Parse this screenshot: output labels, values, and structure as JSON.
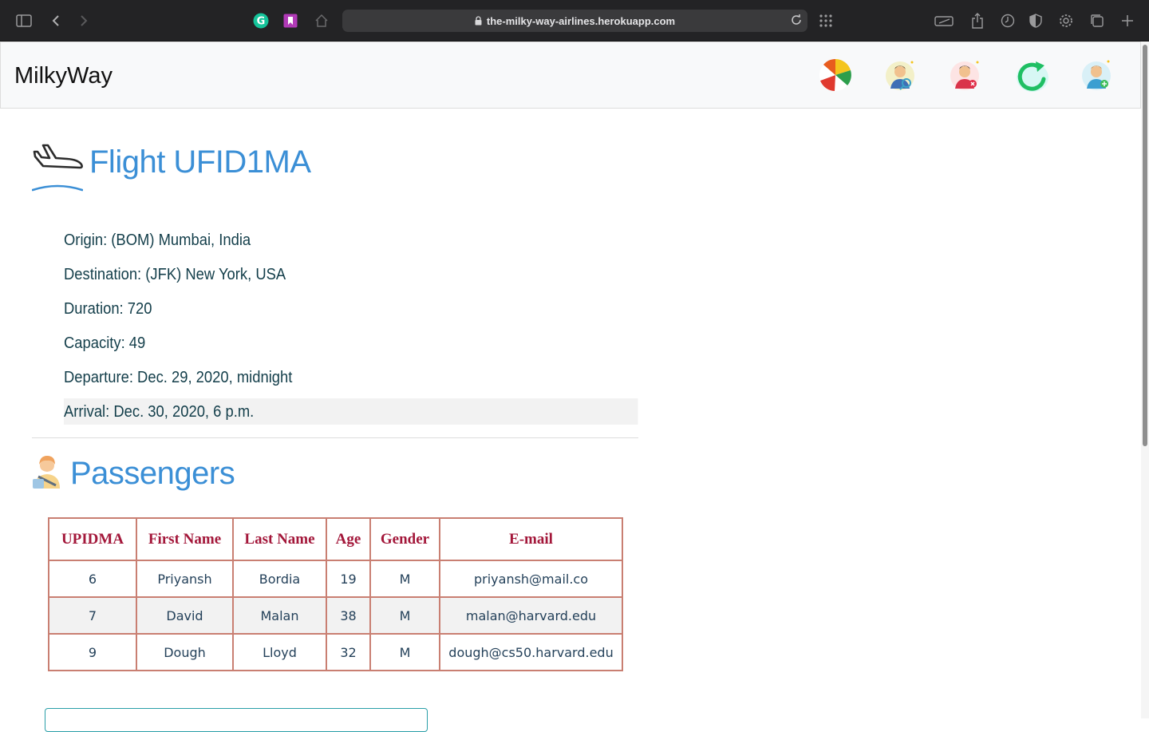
{
  "browser": {
    "url": "the-milky-way-airlines.herokuapp.com"
  },
  "navbar": {
    "brand": "MilkyWay"
  },
  "flight": {
    "title": "Flight UFID1MA",
    "origin": "Origin: (BOM) Mumbai, India",
    "destination": "Destination: (JFK) New York, USA",
    "duration": "Duration: 720",
    "capacity": "Capacity: 49",
    "departure": "Departure: Dec. 29, 2020, midnight",
    "arrival": "Arrival: Dec. 30, 2020, 6 p.m."
  },
  "passengers": {
    "title": "Passengers",
    "headers": [
      "UPIDMA",
      "First Name",
      "Last Name",
      "Age",
      "Gender",
      "E-mail"
    ],
    "rows": [
      [
        "6",
        "Priyansh",
        "Bordia",
        "19",
        "M",
        "priyansh@mail.co"
      ],
      [
        "7",
        "David",
        "Malan",
        "38",
        "M",
        "malan@harvard.edu"
      ],
      [
        "9",
        "Dough",
        "Lloyd",
        "32",
        "M",
        "dough@cs50.harvard.edu"
      ]
    ]
  },
  "colors": {
    "heading": "#3b8fd6",
    "info_text": "#133e4a",
    "table_header": "#a3173a",
    "table_border": "#c97f72"
  }
}
